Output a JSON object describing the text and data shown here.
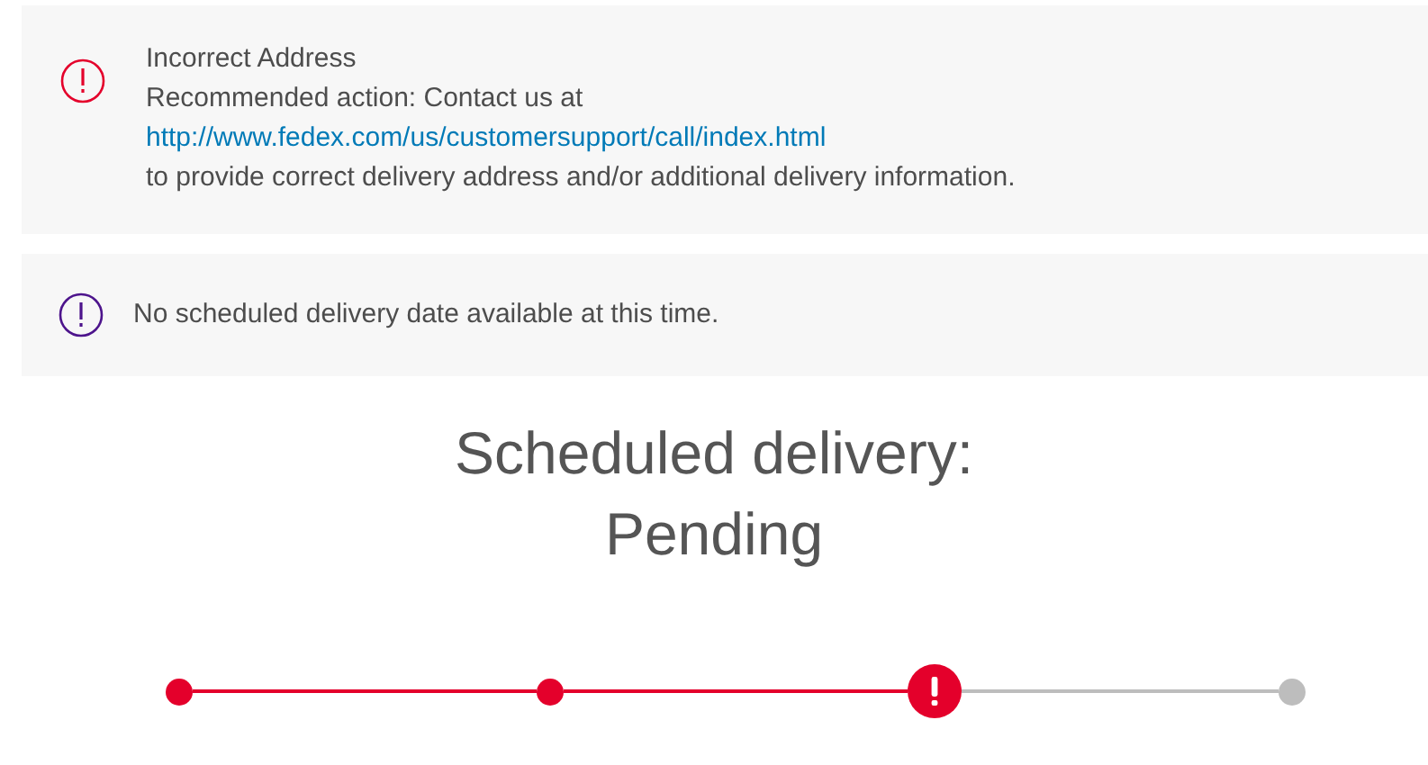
{
  "alerts": [
    {
      "color": "#e4002b",
      "title": "Incorrect Address",
      "lines": [
        "Recommended action: Contact us at"
      ],
      "link": "http://www.fedex.com/us/customersupport/call/index.html",
      "after": "to provide correct delivery address and/or additional delivery information."
    },
    {
      "color": "#4d148c",
      "lines": [
        "No scheduled delivery date available at this time."
      ]
    }
  ],
  "scheduled": {
    "label": "Scheduled delivery:",
    "value": "Pending"
  },
  "progress": [
    {
      "kind": "done"
    },
    {
      "kind": "done"
    },
    {
      "kind": "alert"
    },
    {
      "kind": "pending"
    }
  ]
}
